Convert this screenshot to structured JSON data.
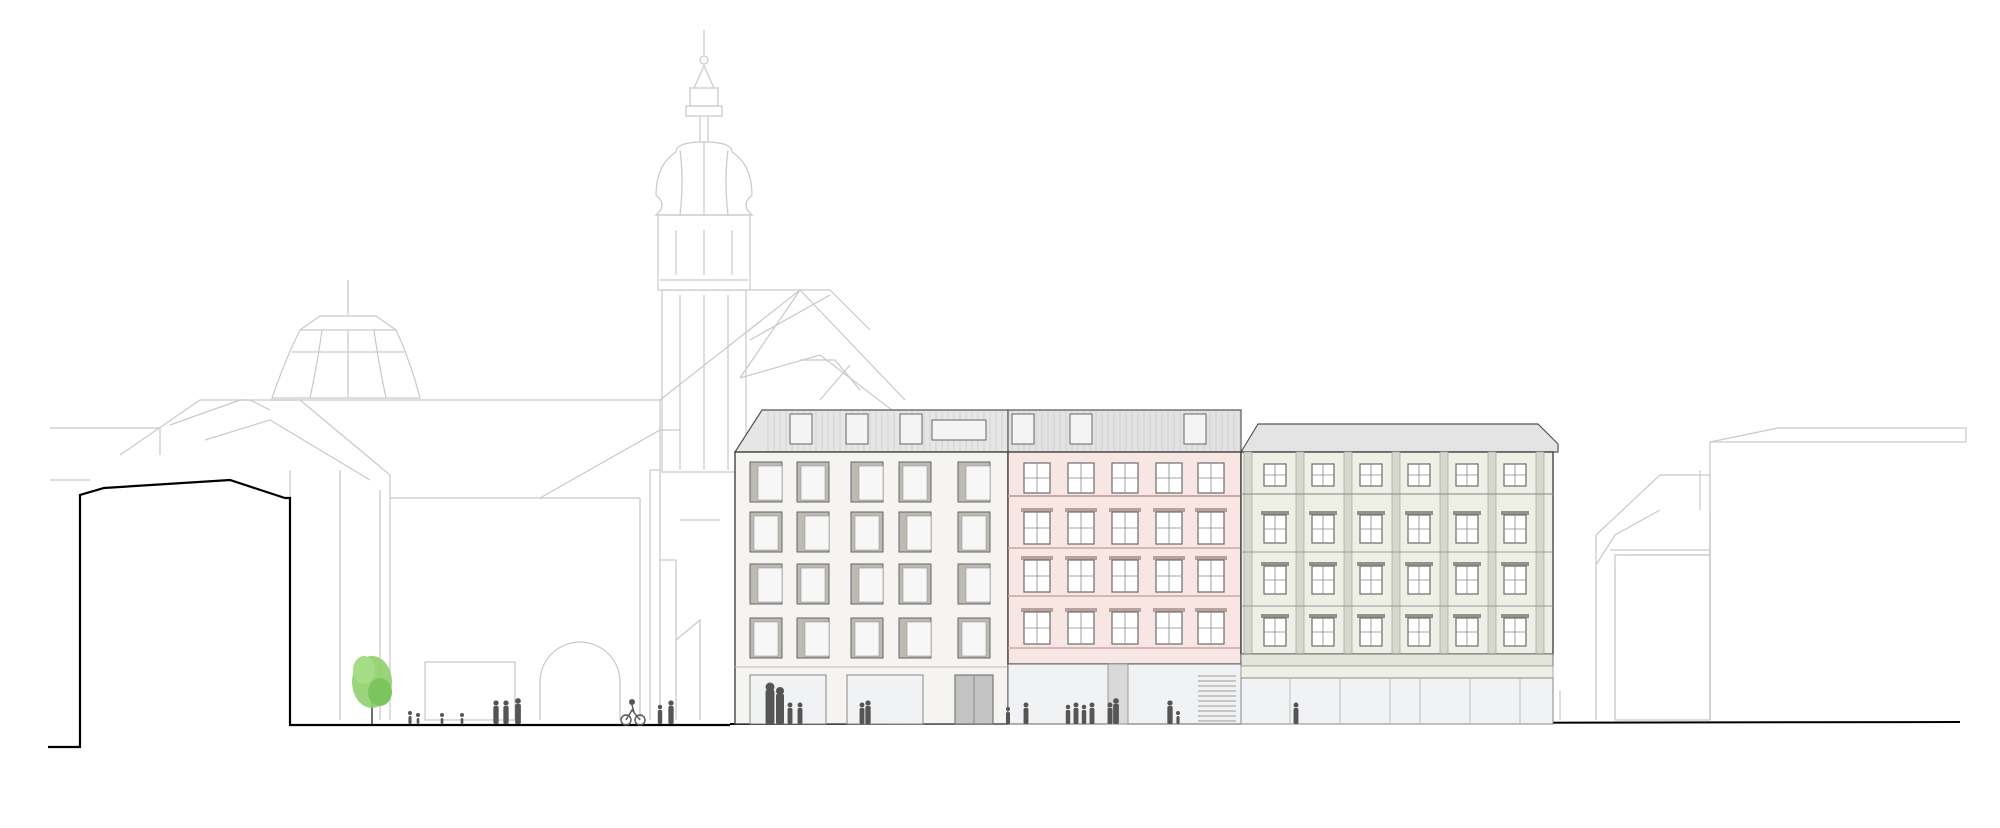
{
  "drawing": {
    "type": "street elevation",
    "colors": {
      "background": "#ffffff",
      "context_line": "#c9c9c9",
      "ground_line": "#000000",
      "section_cut": "#000000",
      "new_building_facade": "#f6f4f1",
      "new_building_reveal": "#bdb9b3",
      "pink_building_facade": "#f7e6e4",
      "pink_building_band": "#e5cfcc",
      "green_building_facade": "#eef0e6",
      "green_building_pilaster": "#d5d8cc",
      "roof_zinc": "#e2e2e2",
      "window_frame": "#7d7d7d",
      "shopfront_glass": "#f1f2f4",
      "tree": "#8fd06d",
      "people": "#555555"
    },
    "elements": {
      "context": [
        "church-spire",
        "church-roof",
        "dome",
        "left-context-buildings",
        "right-context-buildings"
      ],
      "buildings": [
        "section-cut-building",
        "new-building",
        "pink-building",
        "green-building"
      ],
      "entourage": [
        "tree",
        "pedestrians",
        "cyclist"
      ]
    }
  }
}
